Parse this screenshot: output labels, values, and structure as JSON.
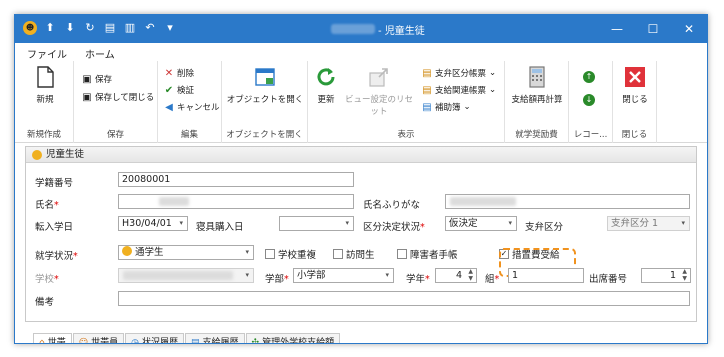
{
  "window": {
    "title": "- 児童生徒",
    "controls": {
      "minimize": "—",
      "maximize": "☐",
      "close": "✕"
    }
  },
  "qat": {
    "items": [
      "☻",
      "⬆",
      "⬇",
      "↻",
      "▤",
      "▥",
      "↶",
      "▾"
    ]
  },
  "menu": {
    "file": "ファイル",
    "home": "ホーム"
  },
  "ribbon": {
    "new_group": {
      "label": "新規作成",
      "new_label": "新規"
    },
    "save_group": {
      "label": "保存",
      "save": "保存",
      "save_close": "保存して閉じる"
    },
    "edit_group": {
      "label": "編集",
      "delete": "削除",
      "verify": "検証",
      "cancel": "キャンセル"
    },
    "object_group": {
      "label": "オブジェクトを開く",
      "open_object": "オブジェクトを開く"
    },
    "view_group": {
      "label": "表示",
      "refresh": "更新",
      "reset_view": "ビュー設定のリセット",
      "ledger1": "支弁区分帳票",
      "ledger2": "支給関連帳票",
      "ledger3": "補助簿"
    },
    "aid_group": {
      "label": "就学奨励費",
      "recalc": "支給額再計算"
    },
    "record_group": {
      "label": "レコー..."
    },
    "close_group": {
      "label": "閉じる",
      "close": "閉じる"
    }
  },
  "panel": {
    "title": "児童生徒",
    "fields": {
      "student_no_label": "学籍番号",
      "student_no": "20080001",
      "name_label": "氏名",
      "kana_label": "氏名ふりがな",
      "transfer_label": "転入学日",
      "transfer_date": "H30/04/01",
      "dorm_label": "寝具購入日",
      "status_decision_label": "区分決定状況",
      "status_decision": "仮決定",
      "payment_div_label": "支弁区分",
      "payment_div": "支弁区分 1",
      "enroll_label": "就学状況",
      "enroll": "通学生",
      "chk_multi": "学校重複",
      "chk_visit": "訪問生",
      "chk_disabled": "障害者手帳",
      "chk_measure": "措置費受給",
      "school_label": "学校",
      "dept_label": "学部",
      "dept": "小学部",
      "grade_label": "学年",
      "grade": "4",
      "class_label": "組",
      "class_val": "1",
      "attend_label": "出席番号",
      "attend": "1",
      "note_label": "備考"
    }
  },
  "tabs": [
    {
      "icon": "⌂",
      "label": "世帯"
    },
    {
      "icon": "☺",
      "label": "世帯員"
    },
    {
      "icon": "◷",
      "label": "状況履歴"
    },
    {
      "icon": "▤",
      "label": "支給履歴"
    },
    {
      "icon": "✣",
      "label": "管理外学校支給額"
    }
  ]
}
